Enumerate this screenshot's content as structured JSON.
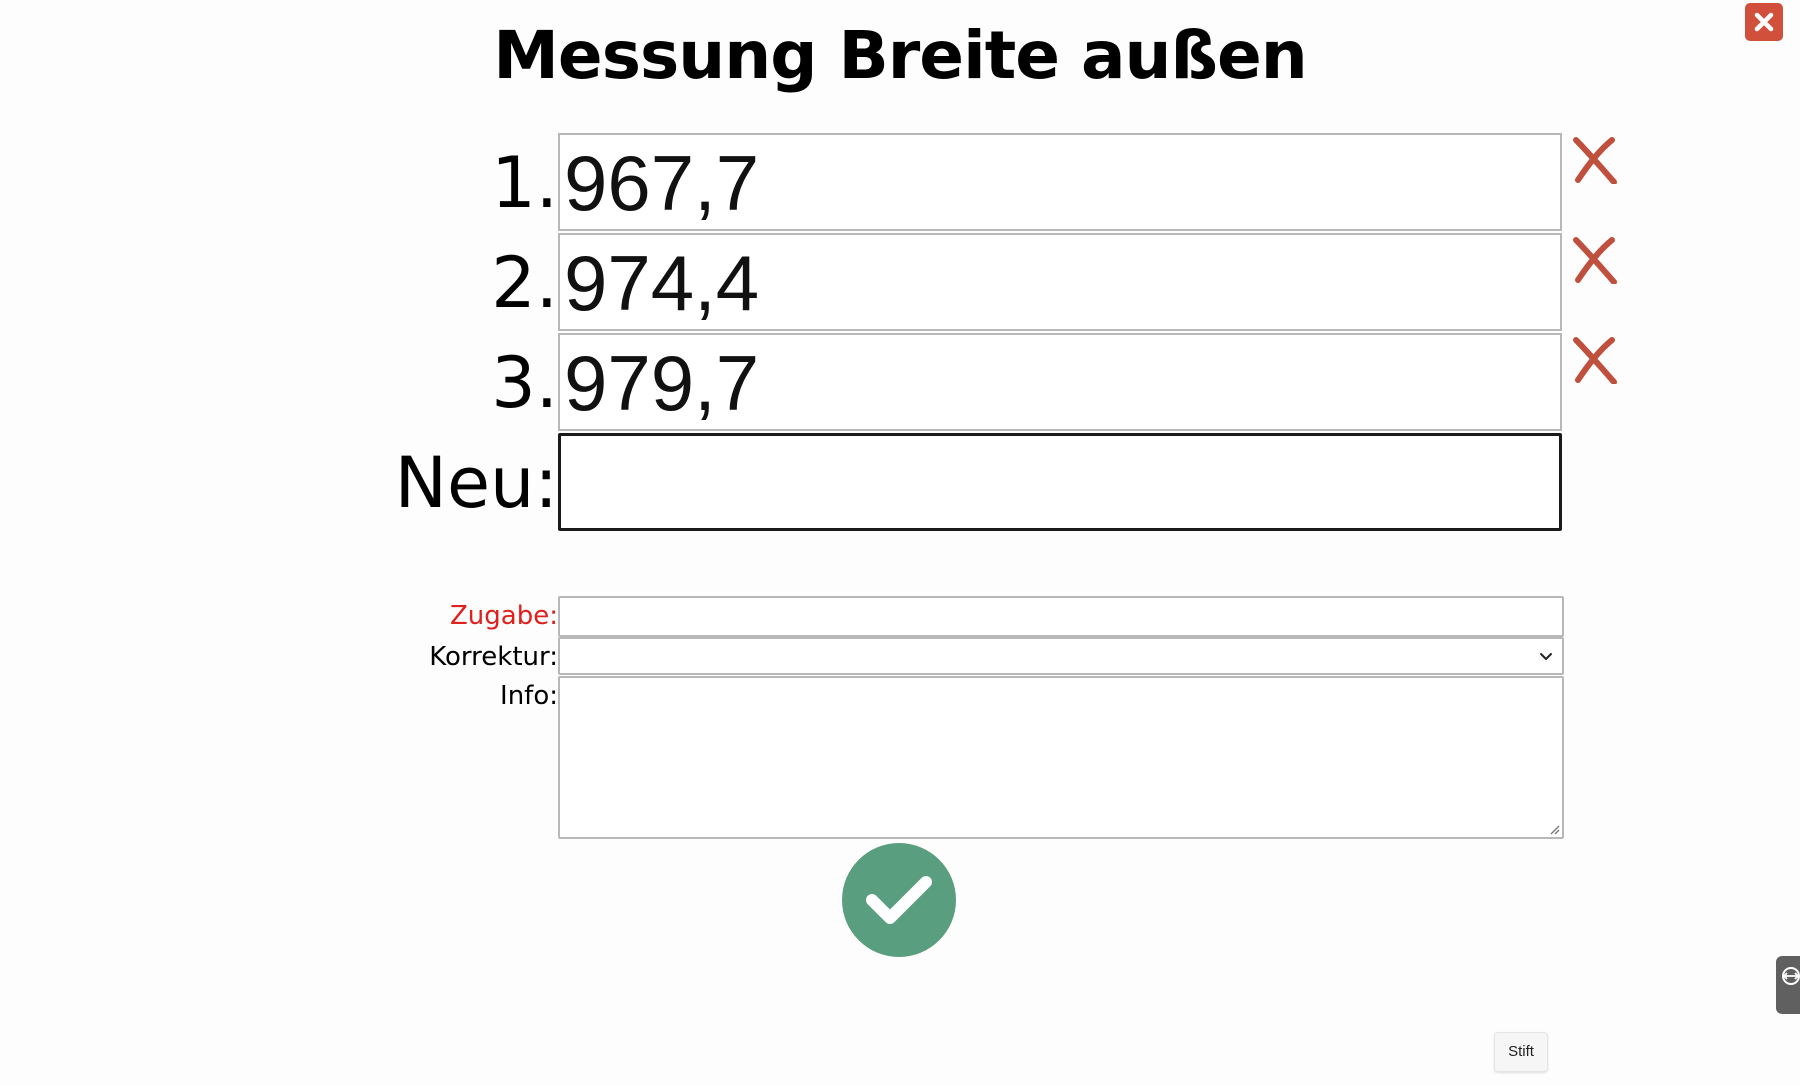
{
  "window": {
    "close_icon": "close-x-icon",
    "close_color": "#d1503b"
  },
  "title": "Messung Breite außen",
  "measurements": [
    {
      "label": "1.",
      "value": "967,7"
    },
    {
      "label": "2.",
      "value": "974,4"
    },
    {
      "label": "3.",
      "value": "979,7"
    }
  ],
  "delete_icon": "delete-x-icon",
  "delete_color": "#c0503e",
  "new_entry": {
    "label": "Neu:",
    "value": ""
  },
  "form": {
    "zugabe_label": "Zugabe:",
    "zugabe_value": "",
    "zugabe_label_color": "#e0201d",
    "korrektur_label": "Korrektur:",
    "korrektur_selected": "",
    "info_label": "Info:",
    "info_value": ""
  },
  "confirm": {
    "icon": "checkmark-icon",
    "color": "#5a9e80"
  },
  "side_tab": {
    "icon": "teamviewer-icon"
  },
  "pen_button": {
    "label": "Stift"
  }
}
